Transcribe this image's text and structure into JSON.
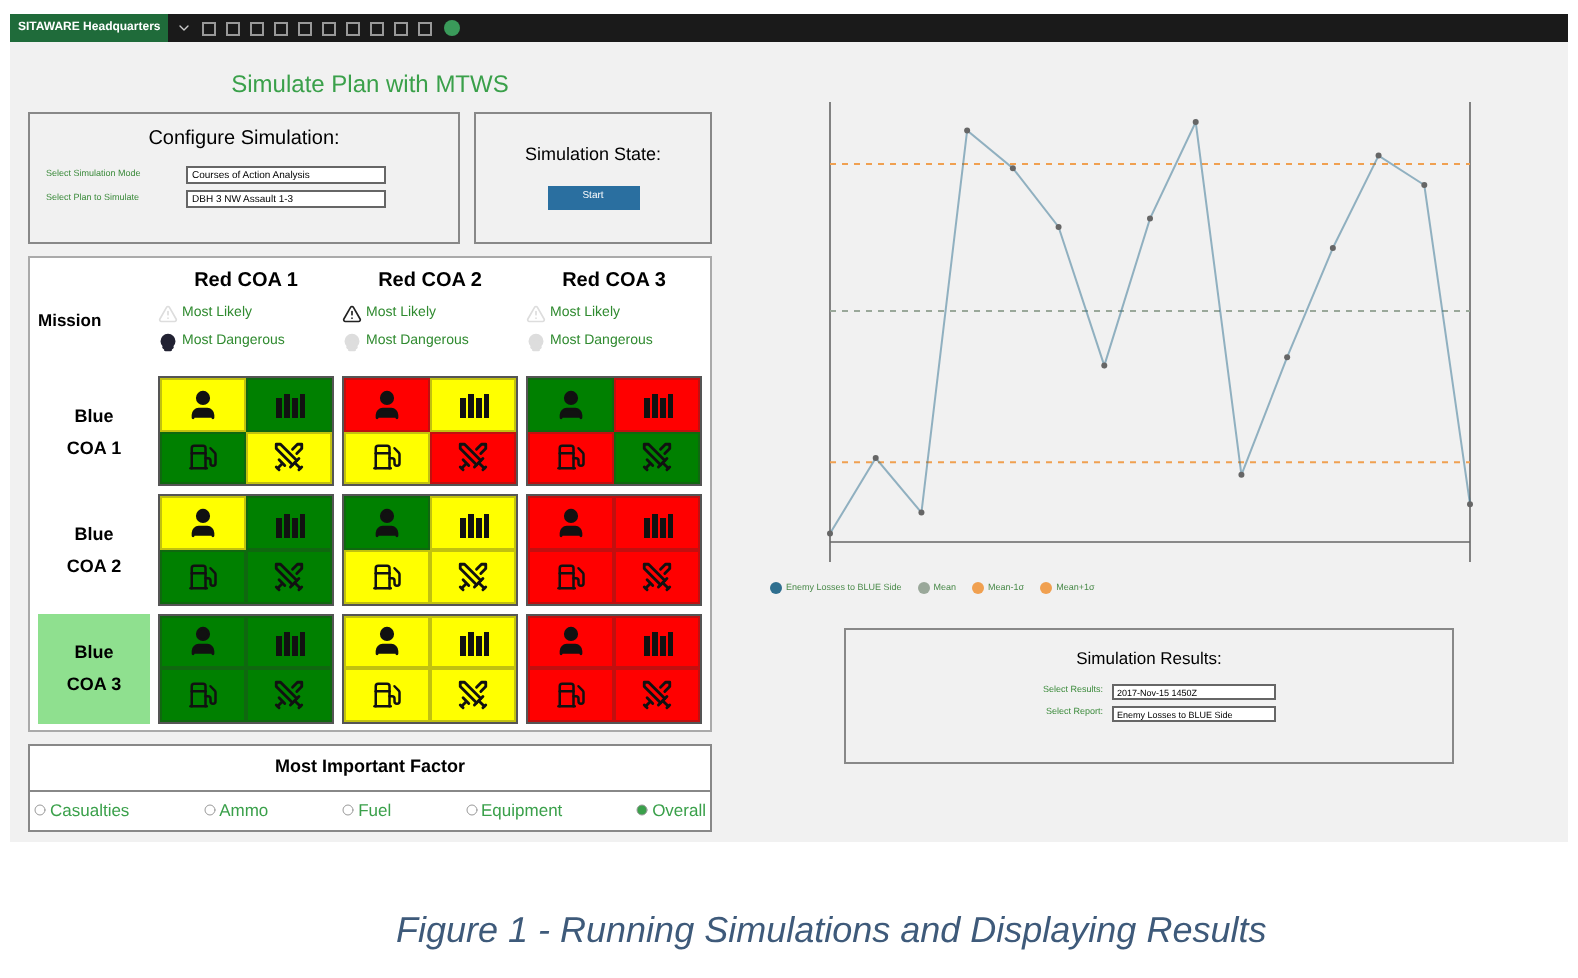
{
  "toolbar": {
    "app_name": "SITAWARE Headquarters"
  },
  "title": "Simulate Plan with MTWS",
  "configure": {
    "heading": "Configure Simulation:",
    "fields": [
      {
        "label": "Select Simulation Mode",
        "value": "Courses of Action Analysis"
      },
      {
        "label": "Select Plan to Simulate",
        "value": "DBH 3 NW Assault 1-3"
      }
    ]
  },
  "state": {
    "heading": "Simulation State:",
    "button": "Start"
  },
  "matrix": {
    "mission_label": "Mission",
    "columns": [
      {
        "title": "Red COA 1",
        "legend": [
          {
            "label": "Most Likely",
            "active": false
          },
          {
            "label": "Most Dangerous",
            "active": true
          }
        ]
      },
      {
        "title": "Red COA 2",
        "legend": [
          {
            "label": "Most Likely",
            "active": true
          },
          {
            "label": "Most Dangerous",
            "active": false
          }
        ]
      },
      {
        "title": "Red COA 3",
        "legend": [
          {
            "label": "Most Likely",
            "active": false
          },
          {
            "label": "Most Dangerous",
            "active": false
          }
        ]
      }
    ],
    "rows": [
      {
        "label": "Blue COA 1",
        "selected": false,
        "cells": [
          [
            {
              "color": "#ffff00"
            },
            {
              "color": "#008000"
            },
            {
              "color": "#008000"
            },
            {
              "color": "#ffff00"
            }
          ],
          [
            {
              "color": "#ff0000"
            },
            {
              "color": "#ffff00"
            },
            {
              "color": "#ffff00"
            },
            {
              "color": "#ff0000"
            }
          ],
          [
            {
              "color": "#008000"
            },
            {
              "color": "#ff0000"
            },
            {
              "color": "#ff0000"
            },
            {
              "color": "#008000"
            }
          ]
        ]
      },
      {
        "label": "Blue COA 2",
        "selected": false,
        "cells": [
          [
            {
              "color": "#ffff00"
            },
            {
              "color": "#008000"
            },
            {
              "color": "#008000"
            },
            {
              "color": "#008000"
            }
          ],
          [
            {
              "color": "#008000"
            },
            {
              "color": "#ffff00"
            },
            {
              "color": "#ffff00"
            },
            {
              "color": "#ffff00"
            }
          ],
          [
            {
              "color": "#ff0000"
            },
            {
              "color": "#ff0000"
            },
            {
              "color": "#ff0000"
            },
            {
              "color": "#ff0000"
            }
          ]
        ]
      },
      {
        "label": "Blue COA 3",
        "selected": true,
        "cells": [
          [
            {
              "color": "#008000"
            },
            {
              "color": "#008000"
            },
            {
              "color": "#008000"
            },
            {
              "color": "#008000"
            }
          ],
          [
            {
              "color": "#ffff00"
            },
            {
              "color": "#ffff00"
            },
            {
              "color": "#ffff00"
            },
            {
              "color": "#ffff00"
            }
          ],
          [
            {
              "color": "#ff0000"
            },
            {
              "color": "#ff0000"
            },
            {
              "color": "#ff0000"
            },
            {
              "color": "#ff0000"
            }
          ]
        ]
      }
    ]
  },
  "factor": {
    "heading": "Most Important Factor",
    "options": [
      {
        "label": "Casualties",
        "selected": false
      },
      {
        "label": "Ammo",
        "selected": false
      },
      {
        "label": "Fuel",
        "selected": false
      },
      {
        "label": "Equipment",
        "selected": false
      },
      {
        "label": "Overall",
        "selected": true
      }
    ]
  },
  "chart": {
    "legend": [
      {
        "label": "Enemy Losses to BLUE Side",
        "color": "#2f6f8f"
      },
      {
        "label": "Mean",
        "color": "#9aa89a"
      },
      {
        "label": "Mean-1σ",
        "color": "#f0a050"
      },
      {
        "label": "Mean+1σ",
        "color": "#f0a050"
      }
    ]
  },
  "results": {
    "heading": "Simulation Results:",
    "fields": [
      {
        "label": "Select Results:",
        "value": "2017-Nov-15 1450Z"
      },
      {
        "label": "Select Report:",
        "value": "Enemy Losses to BLUE Side"
      }
    ]
  },
  "caption": "Figure 1 - Running Simulations and Displaying Results"
}
